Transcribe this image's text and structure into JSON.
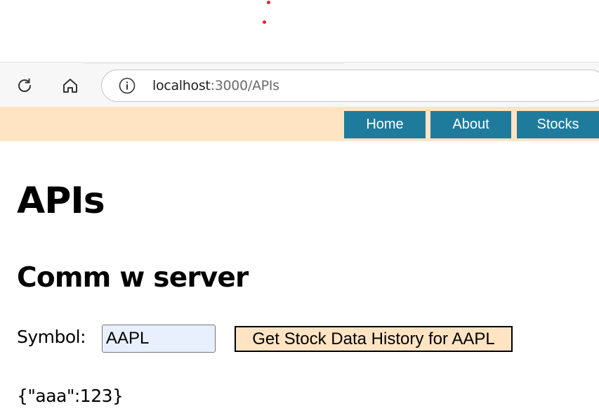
{
  "browser": {
    "url_host": "localhost",
    "url_path": ":3000/APIs",
    "icons": [
      "reload-icon",
      "home-icon",
      "site-info-icon"
    ]
  },
  "nav": {
    "links": [
      "Home",
      "About",
      "Stocks"
    ],
    "bar_color": "#ffe4c4",
    "link_color": "#1f7b9c"
  },
  "page": {
    "title": "APIs",
    "section_title": "Comm w server"
  },
  "form": {
    "symbol_label": "Symbol:",
    "symbol_value": "AAPL",
    "button_label": "Get Stock Data History for AAPL"
  },
  "result": {
    "text": "{\"aaa\":123}"
  }
}
